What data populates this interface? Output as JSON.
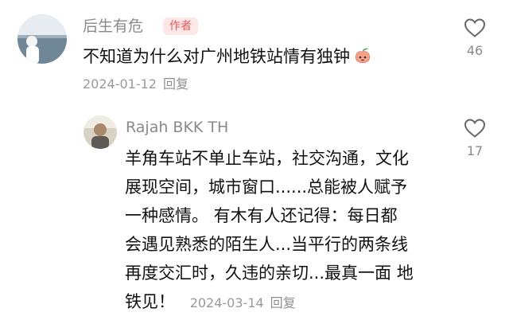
{
  "comment": {
    "username": "后生有危",
    "badge": "作者",
    "text": "不知道为什么对广州地铁站情有独钟",
    "emoji": "peach-face-emoji",
    "date": "2024-01-12",
    "reply_label": "回复",
    "likes": "46"
  },
  "reply": {
    "username": "Rajah BKK TH",
    "lines": [
      "羊角车站不单止车站，社交沟通，文化",
      "展现空间，城市窗口......总能被人赋予",
      "一种感情。 有木有人还记得：每日都",
      "会遇见熟悉的陌生人...当平行的两条线",
      "再度交汇时，久违的亲切...最真一面 地"
    ],
    "last_line": "铁见！",
    "date": "2024-03-14",
    "reply_label": "回复",
    "likes": "17"
  }
}
